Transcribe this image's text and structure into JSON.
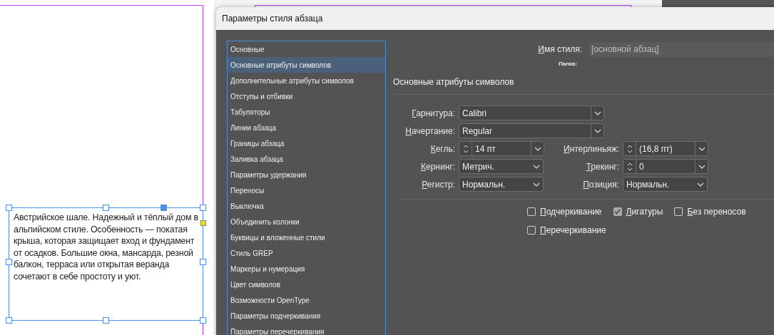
{
  "text_frame": {
    "text": "Австрийское шале. Надежный и тёплый дом в альпийском стиле. Особенность — покатая крыша, которая защищает вход и фундамент от осадков. Большие окна, мансарда, резной балкон, терраса или открытая веранда сочетают в себе простоту и уют."
  },
  "dialog": {
    "title": "Параметры стиля абзаца",
    "categories": [
      {
        "label": "Основные",
        "selected": false
      },
      {
        "label": "Основные атрибуты символов",
        "selected": true
      },
      {
        "label": "Дополнительные атрибуты символов",
        "selected": false
      },
      {
        "label": "Отступы и отбивки",
        "selected": false
      },
      {
        "label": "Табуляторы",
        "selected": false
      },
      {
        "label": "Линии абзаца",
        "selected": false
      },
      {
        "label": "Границы абзаца",
        "selected": false
      },
      {
        "label": "Заливка абзаца",
        "selected": false
      },
      {
        "label": "Параметры удержания",
        "selected": false
      },
      {
        "label": "Переносы",
        "selected": false
      },
      {
        "label": "Выключка",
        "selected": false
      },
      {
        "label": "Объединить колонки",
        "selected": false
      },
      {
        "label": "Буквицы и вложенные стили",
        "selected": false
      },
      {
        "label": "Стиль GREP",
        "selected": false
      },
      {
        "label": "Маркеры и нумерация",
        "selected": false
      },
      {
        "label": "Цвет символов",
        "selected": false
      },
      {
        "label": "Возможности OpenType",
        "selected": false
      },
      {
        "label": "Параметры подчеркивания",
        "selected": false
      },
      {
        "label": "Параметры перечеркивания",
        "selected": false
      }
    ],
    "style_name": {
      "label": "Имя стиля:",
      "value": "[основной абзац]"
    },
    "folder": {
      "label": "Папка:"
    },
    "section_title": "Основные атрибуты символов",
    "rows": [
      {
        "fields": [
          {
            "label": "Гарнитура:",
            "value": "Calibri",
            "kind": "wide"
          }
        ]
      },
      {
        "fields": [
          {
            "label": "Начертание:",
            "value": "Regular",
            "kind": "wide"
          }
        ]
      },
      {
        "fields": [
          {
            "label": "Кегль:",
            "value": "14 пт",
            "kind": "spin"
          },
          {
            "label": "Интерлиньяж:",
            "value": "(16,8 пт)",
            "kind": "spin"
          }
        ]
      },
      {
        "fields": [
          {
            "label": "Кернинг:",
            "value": "Метрич.",
            "kind": "select"
          },
          {
            "label": "Трекинг:",
            "value": "0",
            "kind": "spin"
          }
        ]
      },
      {
        "fields": [
          {
            "label": "Регистр:",
            "value": "Нормальн.",
            "kind": "select"
          },
          {
            "label": "Позиция:",
            "value": "Нормальн.",
            "kind": "select"
          }
        ]
      }
    ],
    "checkbox_rows": [
      [
        {
          "label": "Подчеркивание",
          "checked": false
        },
        {
          "label": "Лигатуры",
          "checked": true
        },
        {
          "label": "Без переносов",
          "checked": false
        }
      ],
      [
        {
          "label": "Перечеркивание",
          "checked": false
        }
      ]
    ]
  }
}
